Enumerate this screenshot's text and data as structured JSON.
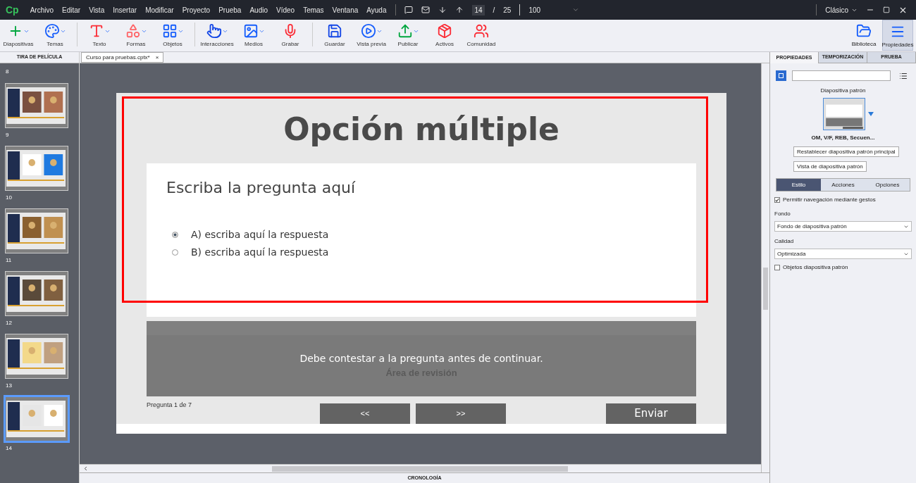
{
  "app": {
    "logo": "Cp",
    "menu": [
      "Archivo",
      "Editar",
      "Vista",
      "Insertar",
      "Modificar",
      "Proyecto",
      "Prueba",
      "Audio",
      "Vídeo",
      "Temas",
      "Ventana",
      "Ayuda"
    ],
    "slide_nav": {
      "current": "14",
      "separator": "/",
      "total": "25",
      "zoom": "100"
    },
    "workspace": "Clásico"
  },
  "toolbar": {
    "left": [
      {
        "label": "Diapositivas",
        "caret": true
      },
      {
        "label": "Temas",
        "caret": true
      },
      {
        "label": "Texto",
        "caret": true
      },
      {
        "label": "Formas",
        "caret": true
      },
      {
        "label": "Objetos",
        "caret": true
      },
      {
        "label": "Interacciones",
        "caret": true
      },
      {
        "label": "Medios",
        "caret": true
      },
      {
        "label": "Grabar",
        "caret": false
      },
      {
        "label": "Guardar",
        "caret": false
      },
      {
        "label": "Vista previa",
        "caret": true
      },
      {
        "label": "Publicar",
        "caret": true
      },
      {
        "label": "Activos",
        "caret": false
      },
      {
        "label": "Comunidad",
        "caret": false
      }
    ],
    "right": [
      {
        "label": "Biblioteca",
        "selected": false
      },
      {
        "label": "Propiedades",
        "selected": true
      }
    ]
  },
  "filmstrip": {
    "title": "TIRA DE PELÍCULA",
    "top_number": "8",
    "slides": [
      {
        "number": "9",
        "selected": false
      },
      {
        "number": "10",
        "selected": false
      },
      {
        "number": "11",
        "selected": false
      },
      {
        "number": "12",
        "selected": false
      },
      {
        "number": "13",
        "selected": false
      },
      {
        "number": "14",
        "selected": true
      }
    ]
  },
  "document_tab": {
    "title": "Curso para pruebas.cptx*",
    "close": "×"
  },
  "slide": {
    "title": "Opción múltiple",
    "question": "Escriba la pregunta aquí",
    "answers": [
      {
        "text": "A) escriba aquí la respuesta",
        "selected": true
      },
      {
        "text": "B) escriba aquí la respuesta",
        "selected": false
      }
    ],
    "feedback": "Debe contestar a la pregunta antes de continuar.",
    "review_area": "Área de revisión",
    "progress": "Pregunta 1 de 7",
    "buttons": [
      "<<",
      ">>"
    ],
    "submit": "Enviar"
  },
  "timeline": {
    "title": "CRONOLOGÍA"
  },
  "properties": {
    "tabs": [
      {
        "label": "PROPIEDADES",
        "selected": true
      },
      {
        "label": "TEMPORIZACIÓN",
        "selected": false
      },
      {
        "label": "PRUEBA",
        "selected": false
      }
    ],
    "master_label": "Diapositiva patrón",
    "master_name": "OM, V/F, REB, Secuen...",
    "buttons": [
      "Restablecer diapositiva patrón principal",
      "Vista de diapositiva patrón"
    ],
    "subtabs": [
      {
        "label": "Estilo",
        "selected": true
      },
      {
        "label": "Acciones",
        "selected": false
      },
      {
        "label": "Opciones",
        "selected": false
      }
    ],
    "gestures": {
      "label": "Permitir navegación mediante gestos",
      "checked": true
    },
    "background": {
      "label": "Fondo",
      "value": "Fondo de diapositiva patrón"
    },
    "quality": {
      "label": "Calidad",
      "value": "Optimizada"
    },
    "master_objects": {
      "label": "Objetos diapositiva patrón",
      "checked": false
    }
  }
}
